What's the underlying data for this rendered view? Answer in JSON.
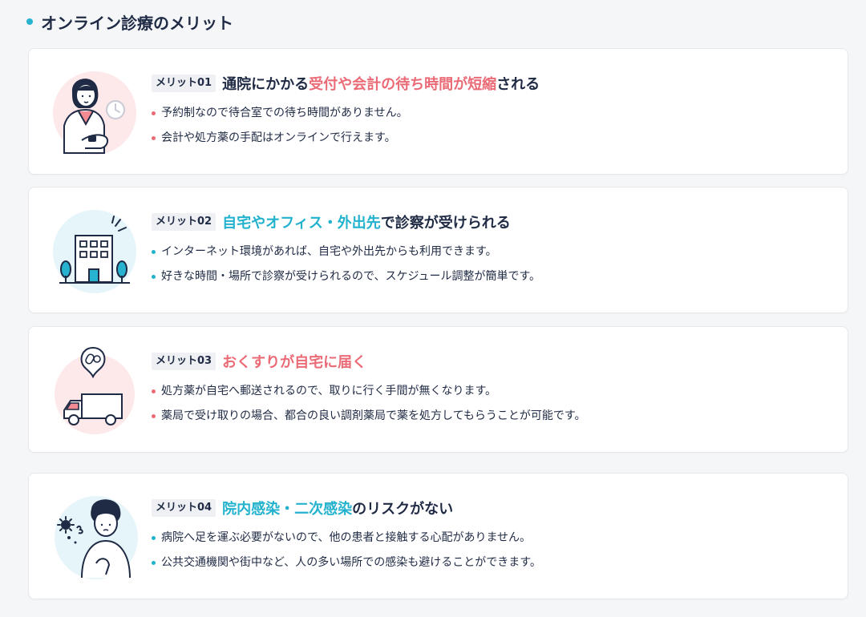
{
  "section": {
    "title": "オンライン診療のメリット"
  },
  "colors": {
    "accent_blue": "#22b2cd",
    "accent_pink": "#ea6b76",
    "text": "#1f2a44"
  },
  "merits": [
    {
      "tag": "メリット01",
      "heading_pre": "通院にかかる",
      "heading_highlight": "受付や会計の待ち時間が短縮",
      "heading_post": "される",
      "highlight_color": "pink",
      "illustration": "woman-checking-watch-clock",
      "bullets": [
        "予約制なので待合室での待ち時間がありません。",
        "会計や処方薬の手配はオンラインで行えます。"
      ]
    },
    {
      "tag": "メリット02",
      "heading_pre": "",
      "heading_highlight": "自宅やオフィス・外出先",
      "heading_post": "で診察が受けられる",
      "highlight_color": "blue",
      "illustration": "office-building-trees",
      "bullets": [
        "インターネット環境があれば、自宅や外出先からも利用できます。",
        "好きな時間・場所で診察が受けられるので、スケジュール調整が簡単です。"
      ]
    },
    {
      "tag": "メリット03",
      "heading_pre": "",
      "heading_highlight": "おくすりが自宅に届く",
      "heading_post": "",
      "highlight_color": "pink",
      "illustration": "delivery-truck-pills",
      "bullets": [
        "処方薬が自宅へ郵送されるので、取りに行く手間が無くなります。",
        "薬局で受け取りの場合、都合の良い調剤薬局で薬を処方してもらうことが可能です。"
      ]
    },
    {
      "tag": "メリット04",
      "heading_pre": "",
      "heading_highlight": "院内感染・二次感染",
      "heading_post": "のリスクがない",
      "highlight_color": "blue",
      "illustration": "man-with-virus",
      "bullets": [
        "病院へ足を運ぶ必要がないので、他の患者と接触する心配がありません。",
        "公共交通機関や街中など、人の多い場所での感染も避けることができます。"
      ]
    }
  ]
}
